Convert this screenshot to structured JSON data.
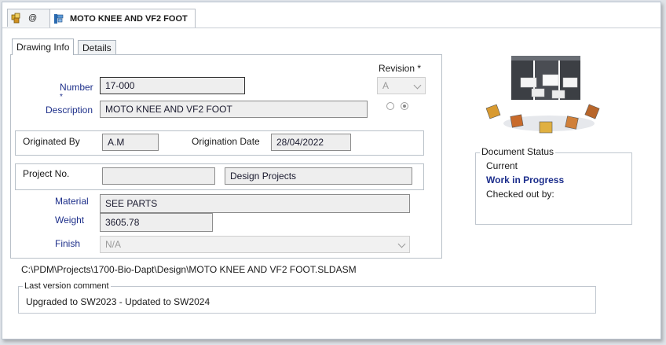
{
  "file_tabs": [
    {
      "label": "@",
      "active": false
    },
    {
      "label": "MOTO KNEE AND VF2 FOOT",
      "active": true
    }
  ],
  "inner_tabs": [
    {
      "label": "Drawing Info",
      "active": true
    },
    {
      "label": "Details",
      "active": false
    }
  ],
  "form": {
    "number_label": "Number",
    "required_marker": "*",
    "number_value": "17-000",
    "description_label": "Description",
    "description_value": "MOTO KNEE AND VF2 FOOT",
    "revision_label": "Revision *",
    "revision_value": "A",
    "originated_by_label": "Originated By",
    "originated_by_value": "A.M",
    "origination_date_label": "Origination Date",
    "origination_date_value": "28/04/2022",
    "project_no_label": "Project No.",
    "project_no_value": "",
    "project_name_value": "Design Projects",
    "material_label": "Material",
    "material_value": "SEE PARTS",
    "weight_label": "Weight",
    "weight_value": "3605.78",
    "finish_label": "Finish",
    "finish_value": "N/A"
  },
  "document_status": {
    "title": "Document Status",
    "current_label": "Current",
    "state": "Work in Progress",
    "checked_out_label": "Checked out by:"
  },
  "file_path": "C:\\PDM\\Projects\\1700-Bio-Dapt\\Design\\MOTO KNEE AND VF2 FOOT.SLDASM",
  "version_comment": {
    "title": "Last version comment",
    "text": "Upgraded to SW2023 - Updated to SW2024"
  }
}
